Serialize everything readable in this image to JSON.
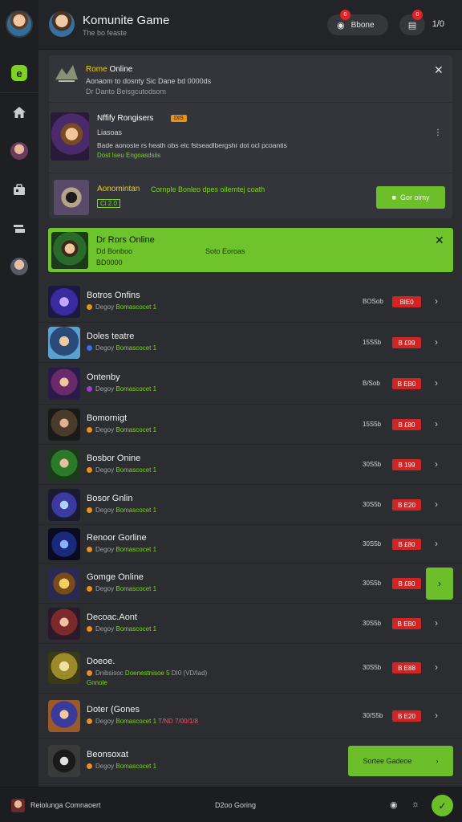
{
  "header": {
    "title": "Komunite Game",
    "subtitle": "The bo feaste",
    "pill1_label": "Bbone",
    "pill1_badge": "0",
    "pill2_badge": "0",
    "count": "1/0"
  },
  "notifications": {
    "row1": {
      "title_a": "Rome",
      "title_b": " Online",
      "body": "Aonaom  to dosnty Sic Dane bd 0000ds",
      "sub": "Dr Danto Beisgcutodsom"
    },
    "row2": {
      "title": "Nffify  Rongisers",
      "tag": "DIS",
      "line1": "Liasoas",
      "line2": "Bade aonoste rs heath obs elc fstseadlbergshr dot ocl pcoantis",
      "line3": "Dost Iseu Engoasdsiis"
    },
    "row3": {
      "title": "Aonomintan",
      "desc": "Cornple Bonleo dpes oilemtej coath",
      "code": "Ci 2.0",
      "join_label": "Gor oimy"
    }
  },
  "banner": {
    "title": "Dr Rors Online",
    "line_a1": "Dd Bonboo",
    "line_a2": "Soto Eoroas",
    "line_b": "BD0000"
  },
  "games": [
    {
      "name": "Botros Onfins",
      "meta_a": "Degoy",
      "meta_b": "Bomascocet 1",
      "players": "BOSob",
      "price": "BIE0",
      "dot": "#e8921a"
    },
    {
      "name": "Doles teatre",
      "meta_a": "Degoy",
      "meta_b": "Bomascocet 1",
      "players": "15S5b",
      "price": "B £99",
      "dot": "#3a6ee8"
    },
    {
      "name": "Ontenby",
      "meta_a": "Degoy",
      "meta_b": "Bomascocet 1",
      "players": "B/Sob",
      "price": "B EB0",
      "dot": "#a43ad8"
    },
    {
      "name": "Bomornigt",
      "meta_a": "Degoy",
      "meta_b": "Bomascocet 1",
      "players": "15S5b",
      "price": "B £80",
      "dot": "#e8921a"
    },
    {
      "name": "Bosbor Onine",
      "meta_a": "Degoy",
      "meta_b": "Bomascocet 1",
      "players": "30S5b",
      "price": "B 199",
      "dot": "#e8921a"
    },
    {
      "name": "Bosor Gnlin",
      "meta_a": "Degoy",
      "meta_b": "Bomascocet 1",
      "players": "30S5b",
      "price": "B E20",
      "dot": "#e8921a"
    },
    {
      "name": "Renoor Gorline",
      "meta_a": "Degoy",
      "meta_b": "Bomascocet 1",
      "players": "30S5b",
      "price": "B £80",
      "dot": "#e8921a"
    },
    {
      "name": "Gomge Online",
      "meta_a": "Degoy",
      "meta_b": "Bomascocet 1",
      "players": "30S5b",
      "price": "B £80",
      "dot": "#e8921a"
    },
    {
      "name": "Decoac.Aont",
      "meta_a": "Degoy",
      "meta_b": "Bomascocet 1",
      "players": "30S5b",
      "price": "B EB0",
      "dot": "#e8921a"
    },
    {
      "name": "Doeoe.",
      "meta_a": "Dnibsisoc",
      "meta_b": "Doenestnisoe 5",
      "meta_c": "DI0 (VD/Iad)",
      "meta_d": "Gnnole",
      "players": "30S5b",
      "price": "B E88",
      "dot": "#e8921a"
    },
    {
      "name": "Doter (Gones",
      "meta_a": "Degoy",
      "meta_b": "Bomascocet 1",
      "meta_c": "T/ND 7/00/1/8",
      "players": "30/S5b",
      "price": "B E20",
      "dot": "#e8921a"
    },
    {
      "name": "Beonsoxat",
      "meta_a": "Degoy",
      "meta_b": "Bomascocet 1",
      "wide_label": "Sortee Gadeoe"
    }
  ],
  "footer": {
    "left_label": "Reiolunga Comnaoert",
    "mid_label": "D2oo Goring"
  },
  "colors": {
    "accent_green": "#6cbf2a",
    "price_red": "#d12424",
    "badge_red": "#d9262a",
    "bg_dark": "#1e1f22",
    "bg_panel": "#2b2d30"
  }
}
